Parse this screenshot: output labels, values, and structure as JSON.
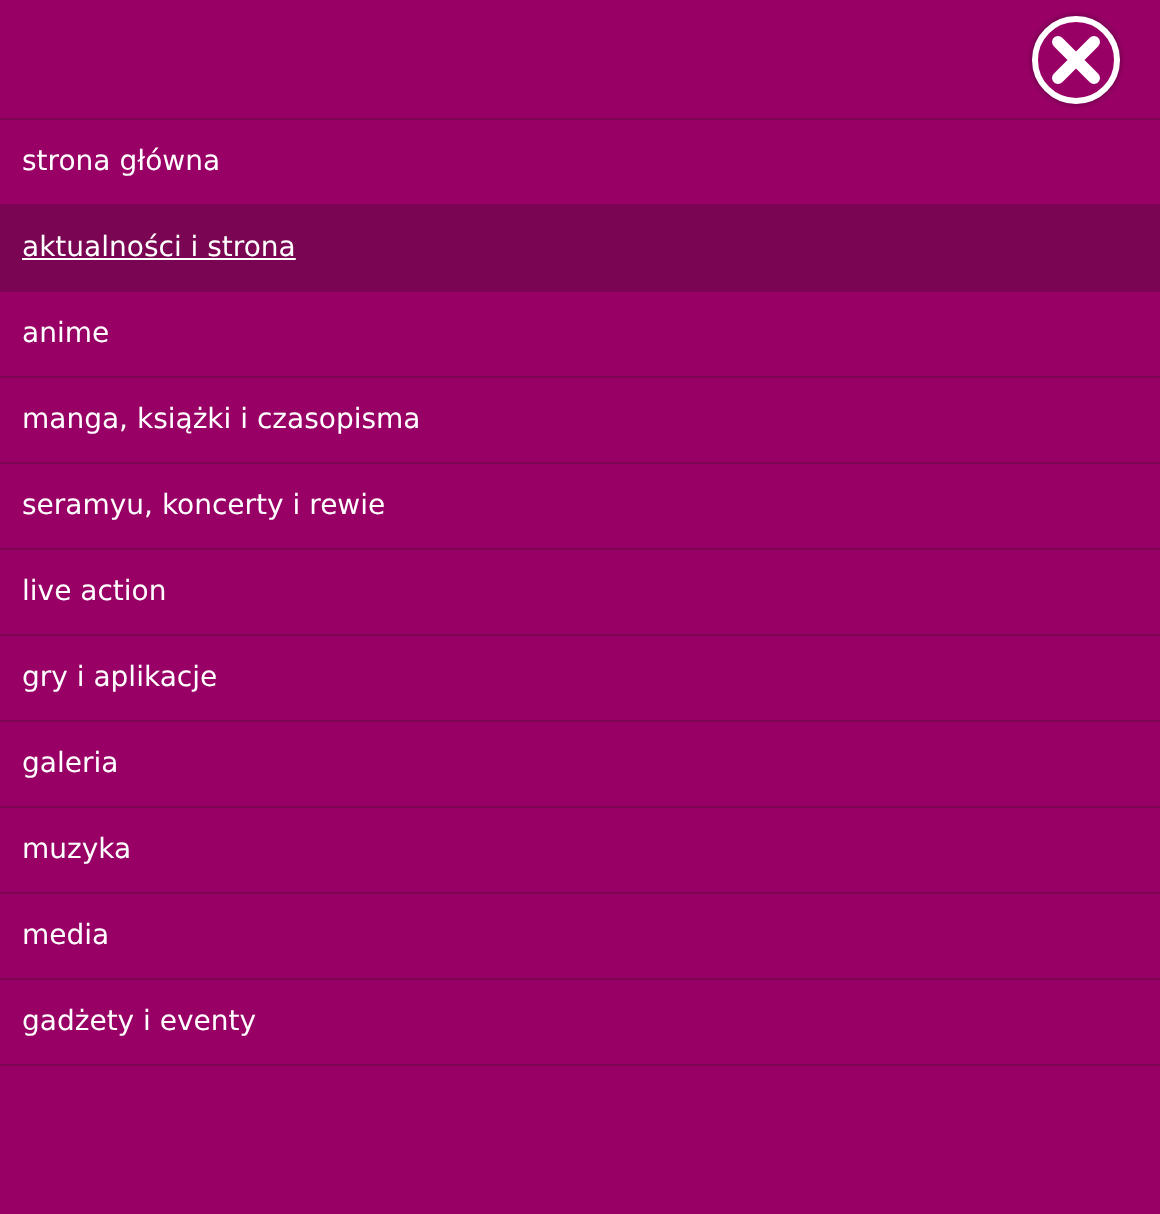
{
  "menu": {
    "items": [
      {
        "label": "strona główna",
        "selected": false
      },
      {
        "label": "aktualności i strona",
        "selected": true
      },
      {
        "label": "anime",
        "selected": false
      },
      {
        "label": "manga, książki i czasopisma",
        "selected": false
      },
      {
        "label": "seramyu, koncerty i rewie",
        "selected": false
      },
      {
        "label": "live action",
        "selected": false
      },
      {
        "label": "gry i aplikacje",
        "selected": false
      },
      {
        "label": "galeria",
        "selected": false
      },
      {
        "label": "muzyka",
        "selected": false
      },
      {
        "label": "media",
        "selected": false
      },
      {
        "label": "gadżety i eventy",
        "selected": false
      }
    ]
  }
}
